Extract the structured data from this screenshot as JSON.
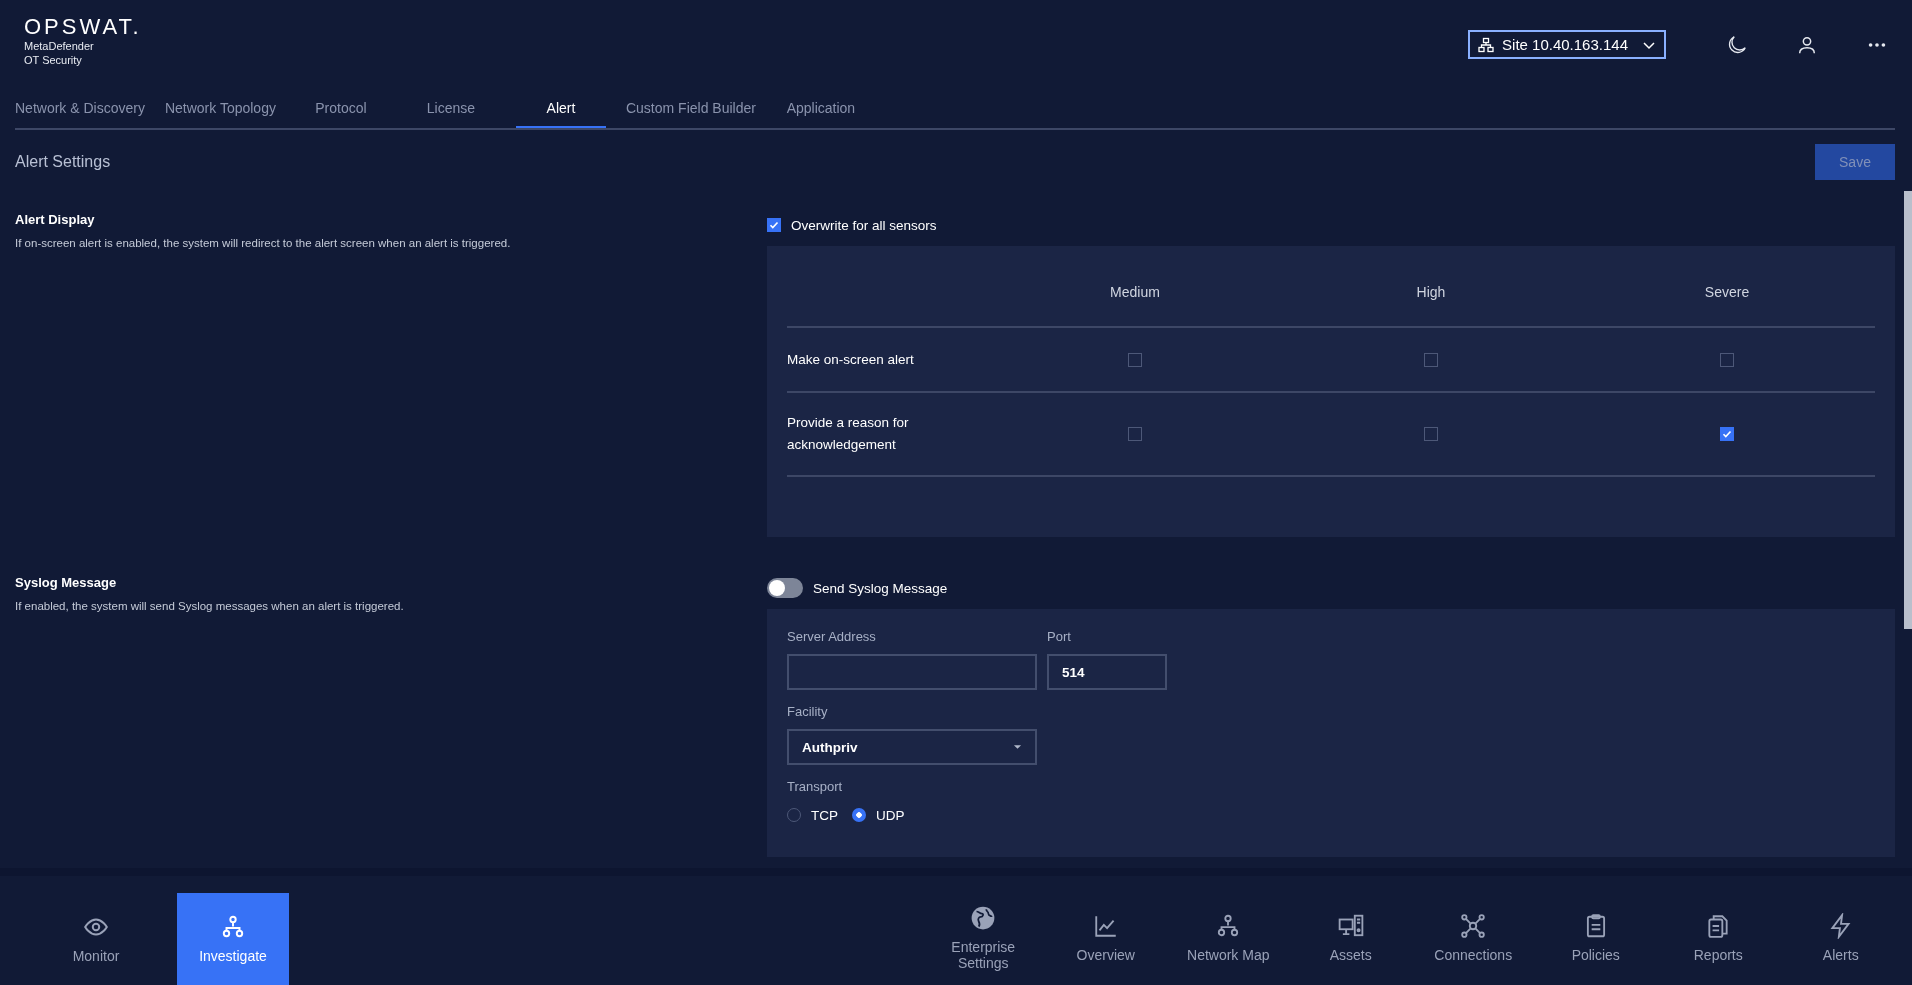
{
  "brand": {
    "logo": "OPSWAT.",
    "product_line1": "MetaDefender",
    "product_line2": "OT Security"
  },
  "header": {
    "site_selector": "Site 10.40.163.144"
  },
  "tabs": [
    {
      "label": "Network & Discovery",
      "selected": false
    },
    {
      "label": "Network Topology",
      "selected": false
    },
    {
      "label": "Protocol",
      "selected": false
    },
    {
      "label": "License",
      "selected": false
    },
    {
      "label": "Alert",
      "selected": true
    },
    {
      "label": "Custom Field Builder",
      "selected": false
    },
    {
      "label": "Application",
      "selected": false
    }
  ],
  "page": {
    "title": "Alert Settings",
    "save_button": "Save"
  },
  "alert_display": {
    "title": "Alert Display",
    "description": "If on-screen alert is enabled, the system will redirect to the alert screen when an alert is triggered.",
    "overwrite": {
      "label": "Overwrite for all sensors",
      "checked": true
    },
    "columns": [
      "Medium",
      "High",
      "Severe"
    ],
    "rows": [
      {
        "label": "Make on-screen alert",
        "checks": [
          false,
          false,
          false
        ]
      },
      {
        "label": "Provide a reason for acknowledgement",
        "checks": [
          false,
          false,
          true
        ]
      }
    ]
  },
  "syslog": {
    "title": "Syslog Message",
    "description": "If enabled, the system will send Syslog messages when an alert is triggered.",
    "toggle": {
      "label": "Send Syslog Message",
      "on": false
    },
    "server_address": {
      "label": "Server Address"
    },
    "port": {
      "label": "Port",
      "value": "514"
    },
    "facility": {
      "label": "Facility",
      "value": "Authpriv"
    },
    "transport": {
      "label": "Transport",
      "options": [
        {
          "label": "TCP",
          "selected": false
        },
        {
          "label": "UDP",
          "selected": true
        }
      ]
    }
  },
  "bottom_nav_left": [
    {
      "label": "Monitor",
      "selected": false
    },
    {
      "label": "Investigate",
      "selected": true
    }
  ],
  "bottom_nav_right": [
    {
      "label": "Enterprise Settings"
    },
    {
      "label": "Overview"
    },
    {
      "label": "Network Map"
    },
    {
      "label": "Assets"
    },
    {
      "label": "Connections"
    },
    {
      "label": "Policies"
    },
    {
      "label": "Reports"
    },
    {
      "label": "Alerts"
    }
  ]
}
